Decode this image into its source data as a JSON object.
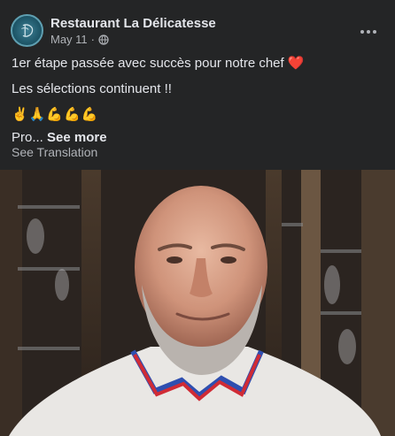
{
  "post": {
    "page_name": "Restaurant La Délicatesse",
    "date": "May 11",
    "separator": "·",
    "privacy_icon": "globe-icon",
    "more_icon": "more-options-icon",
    "line1": "1er étape passée avec succès pour notre chef",
    "heart_emoji": "❤️",
    "line2": "Les sélections continuent !!",
    "emoji_line": "✌️🙏💪💪💪",
    "truncated": "Pro...",
    "see_more": "See more",
    "see_translation": "See Translation"
  },
  "photo": {
    "subject": "chef-portrait-image"
  },
  "colors": {
    "card_bg": "#242526",
    "text_primary": "#e4e6eb",
    "text_secondary": "#b0b3b8",
    "heart": "#e41e3f"
  }
}
